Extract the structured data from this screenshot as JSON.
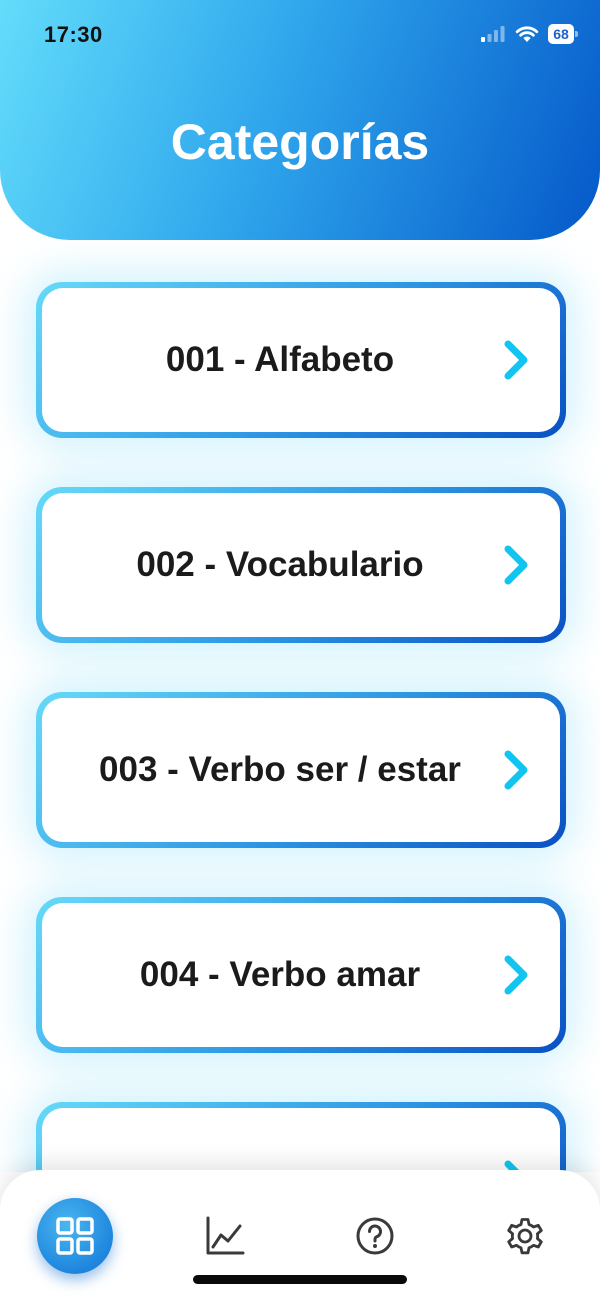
{
  "status_bar": {
    "time": "17:30",
    "battery": "68"
  },
  "header": {
    "title": "Categorías"
  },
  "categories": [
    {
      "label": "001 - Alfabeto"
    },
    {
      "label": "002 - Vocabulario"
    },
    {
      "label": "003 - Verbo ser / estar"
    },
    {
      "label": "004 - Verbo amar"
    },
    {
      "label": ""
    }
  ],
  "tabbar": {
    "items": [
      {
        "icon": "grid-icon",
        "active": true
      },
      {
        "icon": "chart-icon",
        "active": false
      },
      {
        "icon": "help-icon",
        "active": false
      },
      {
        "icon": "gear-icon",
        "active": false
      }
    ]
  },
  "colors": {
    "accent": "#1f86de",
    "chevron": "#12c4f0",
    "gradient_start": "#63dcfb",
    "gradient_end": "#0558c9"
  }
}
